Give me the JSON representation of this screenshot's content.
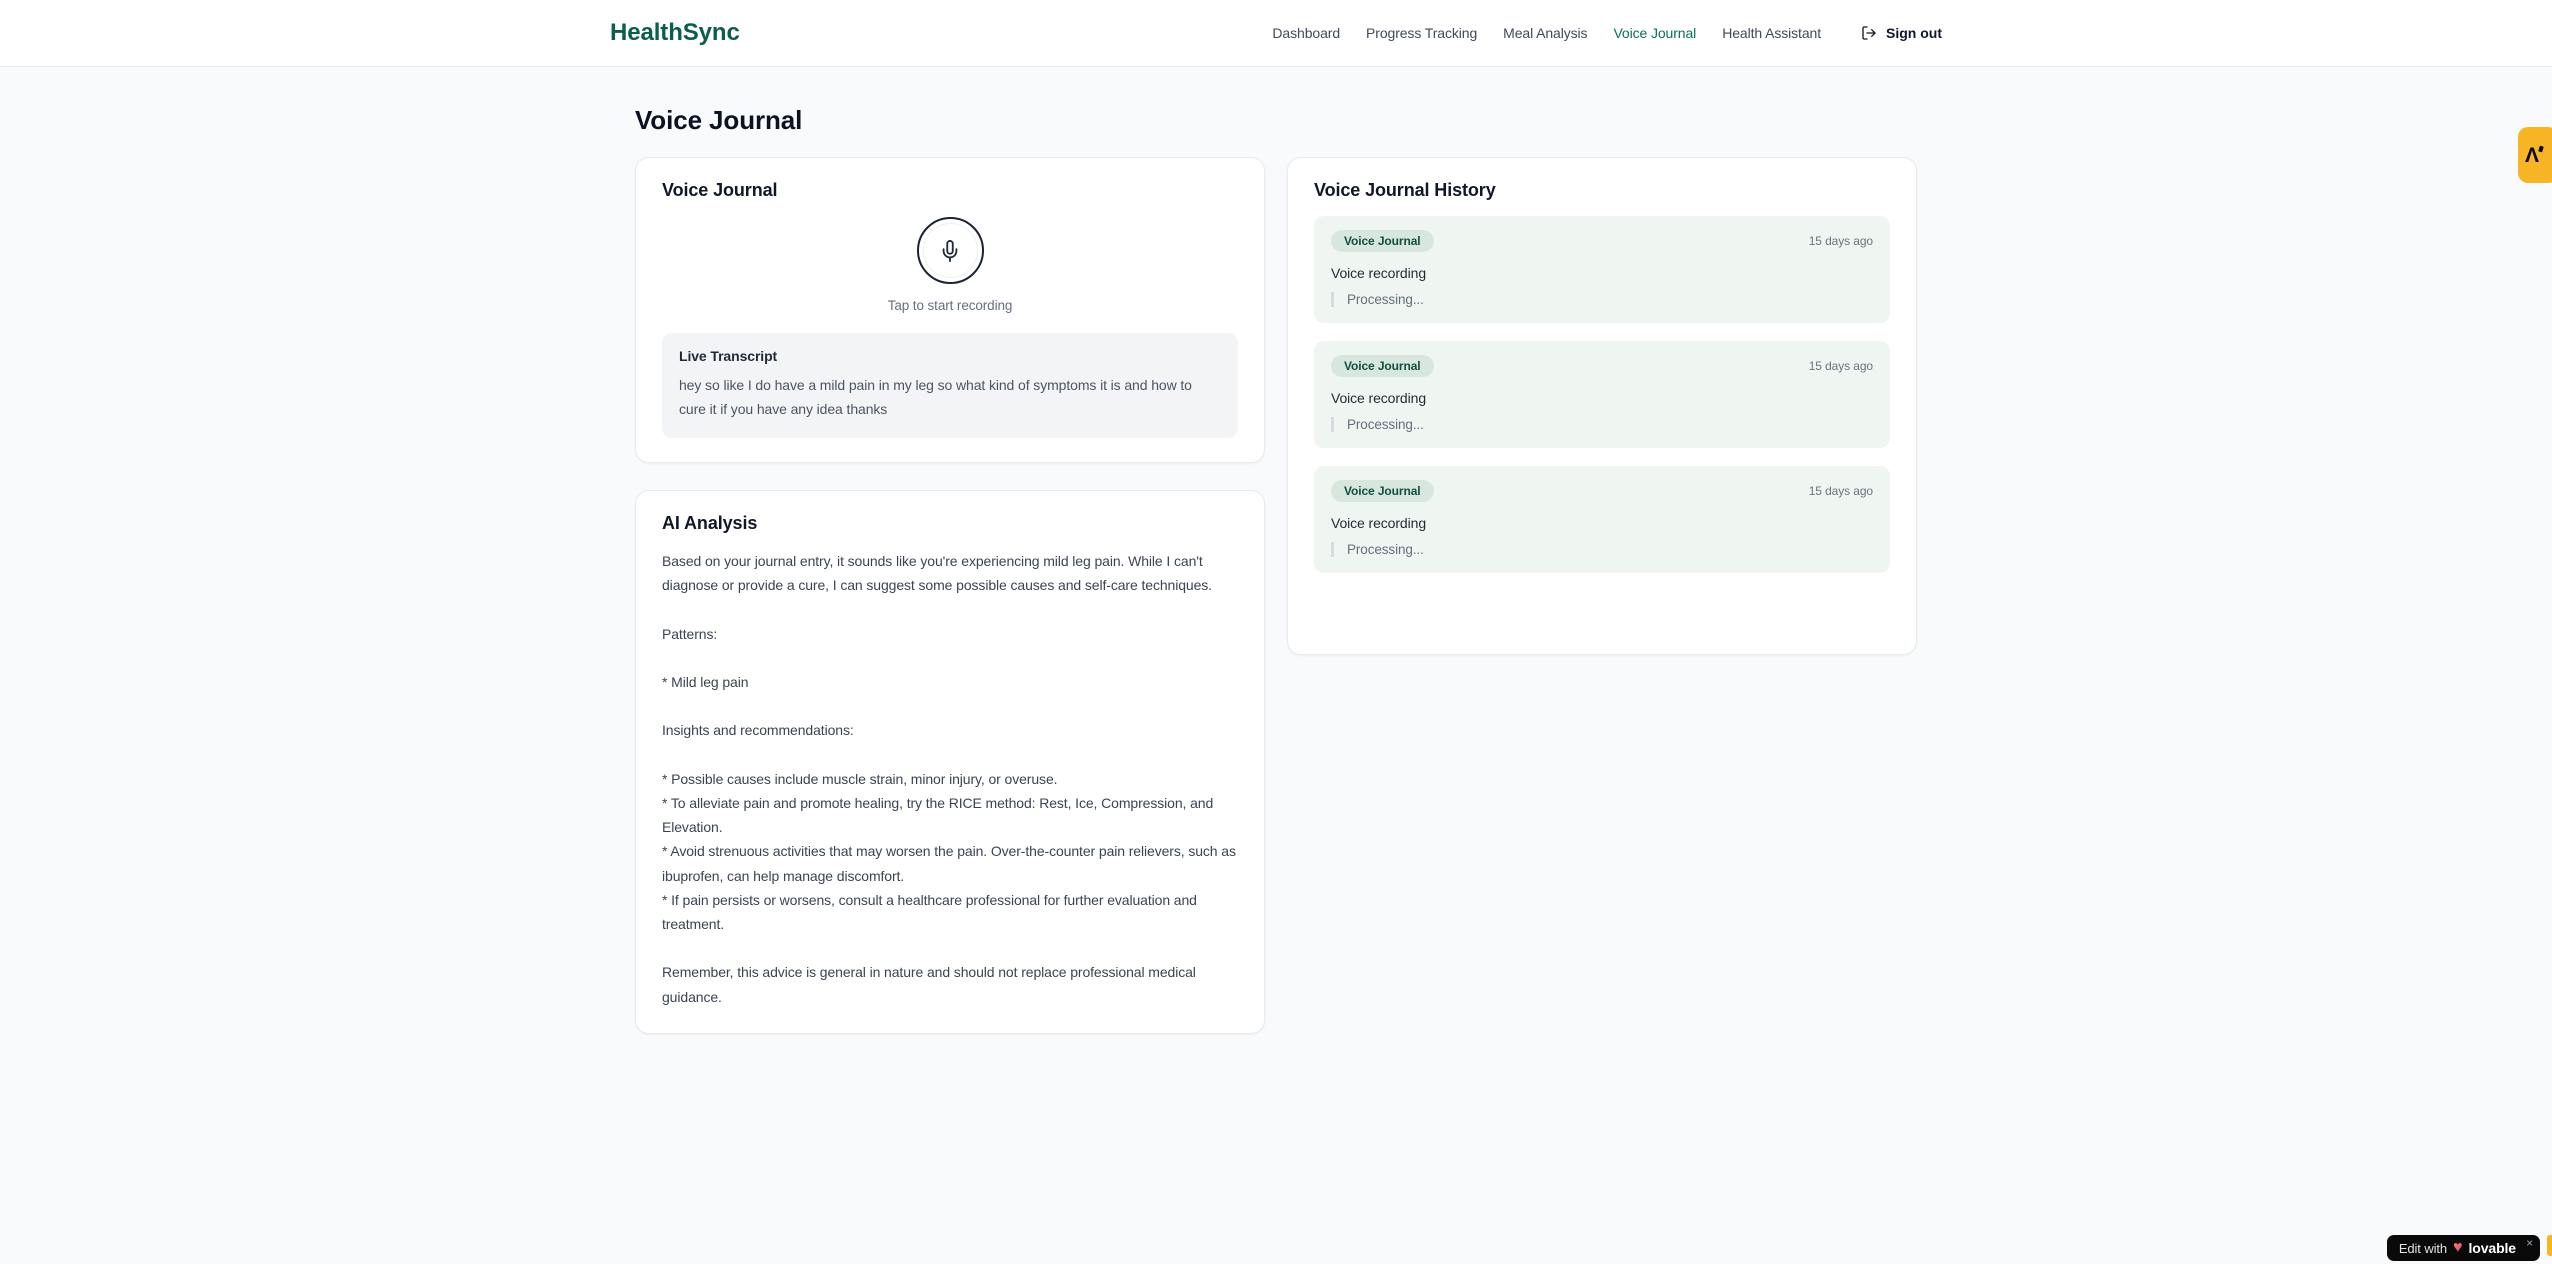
{
  "brand": {
    "name": "HealthSync"
  },
  "nav": {
    "items": [
      {
        "label": "Dashboard",
        "active": false
      },
      {
        "label": "Progress Tracking",
        "active": false
      },
      {
        "label": "Meal Analysis",
        "active": false
      },
      {
        "label": "Voice Journal",
        "active": true
      },
      {
        "label": "Health Assistant",
        "active": false
      }
    ],
    "sign_out_label": "Sign out"
  },
  "page": {
    "title": "Voice Journal"
  },
  "recorder_card": {
    "title": "Voice Journal",
    "tap_hint": "Tap to start recording",
    "transcript_title": "Live Transcript",
    "transcript_text": "hey so like I do have a mild pain in my leg so what kind of symptoms it is and how to cure it if you have any idea thanks"
  },
  "analysis_card": {
    "title": "AI Analysis",
    "body": "Based on your journal entry, it sounds like you're experiencing mild leg pain. While I can't diagnose or provide a cure, I can suggest some possible causes and self-care techniques.\n\nPatterns:\n\n* Mild leg pain\n\nInsights and recommendations:\n\n* Possible causes include muscle strain, minor injury, or overuse.\n* To alleviate pain and promote healing, try the RICE method: Rest, Ice, Compression, and Elevation.\n* Avoid strenuous activities that may worsen the pain. Over-the-counter pain relievers, such as ibuprofen, can help manage discomfort.\n* If pain persists or worsens, consult a healthcare professional for further evaluation and treatment.\n\nRemember, this advice is general in nature and should not replace professional medical guidance."
  },
  "history_card": {
    "title": "Voice Journal History",
    "entries": [
      {
        "badge": "Voice Journal",
        "time": "15 days ago",
        "title": "Voice recording",
        "status": "Processing..."
      },
      {
        "badge": "Voice Journal",
        "time": "15 days ago",
        "title": "Voice recording",
        "status": "Processing..."
      },
      {
        "badge": "Voice Journal",
        "time": "15 days ago",
        "title": "Voice recording",
        "status": "Processing..."
      }
    ]
  },
  "overlays": {
    "side_badge_glyph": "Λ",
    "edit_badge": {
      "prefix": "Edit with",
      "heart": "♥",
      "brand": "lovable",
      "close": "×"
    }
  },
  "colors": {
    "accent_teal": "#0b5d4d",
    "nav_active": "#0e6e5c",
    "page_bg": "#f8fafc",
    "card_border": "#e7eaee",
    "history_entry_bg": "#eff6f1",
    "badge_bg": "#d8e7dd",
    "badge_text": "#134e42",
    "transcript_bg": "#f3f4f6",
    "overlay_orange": "#f7b425",
    "pill_bg": "#0a0a0a"
  },
  "icons": {
    "mic": "mic-icon",
    "logout": "logout-icon",
    "heart": "heart-icon",
    "close": "close-icon"
  }
}
